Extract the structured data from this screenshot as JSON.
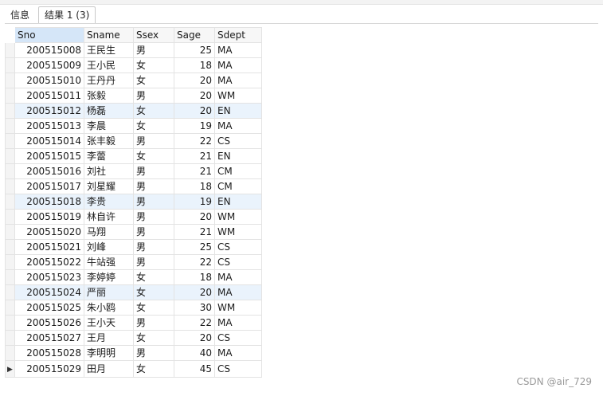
{
  "tabs": [
    {
      "label": "信息",
      "active": false
    },
    {
      "label": "结果 1 (3)",
      "active": true
    }
  ],
  "table": {
    "columns": [
      "Sno",
      "Sname",
      "Ssex",
      "Sage",
      "Sdept"
    ],
    "current_row_marker": "▶",
    "rows": [
      [
        "200515008",
        "王民生",
        "男",
        "25",
        "MA"
      ],
      [
        "200515009",
        "王小民",
        "女",
        "18",
        "MA"
      ],
      [
        "200515010",
        "王丹丹",
        "女",
        "20",
        "MA"
      ],
      [
        "200515011",
        "张毅",
        "男",
        "20",
        "WM"
      ],
      [
        "200515012",
        "杨磊",
        "女",
        "20",
        "EN"
      ],
      [
        "200515013",
        "李晨",
        "女",
        "19",
        "MA"
      ],
      [
        "200515014",
        "张丰毅",
        "男",
        "22",
        "CS"
      ],
      [
        "200515015",
        "李蕾",
        "女",
        "21",
        "EN"
      ],
      [
        "200515016",
        "刘社",
        "男",
        "21",
        "CM"
      ],
      [
        "200515017",
        "刘星耀",
        "男",
        "18",
        "CM"
      ],
      [
        "200515018",
        "李贵",
        "男",
        "19",
        "EN"
      ],
      [
        "200515019",
        "林自许",
        "男",
        "20",
        "WM"
      ],
      [
        "200515020",
        "马翔",
        "男",
        "21",
        "WM"
      ],
      [
        "200515021",
        "刘峰",
        "男",
        "25",
        "CS"
      ],
      [
        "200515022",
        "牛站强",
        "男",
        "22",
        "CS"
      ],
      [
        "200515023",
        "李婷婷",
        "女",
        "18",
        "MA"
      ],
      [
        "200515024",
        "严丽",
        "女",
        "20",
        "MA"
      ],
      [
        "200515025",
        "朱小鸥",
        "女",
        "30",
        "WM"
      ],
      [
        "200515026",
        "王小天",
        "男",
        "22",
        "MA"
      ],
      [
        "200515027",
        "王月",
        "女",
        "20",
        "CS"
      ],
      [
        "200515028",
        "李明明",
        "男",
        "40",
        "MA"
      ],
      [
        "200515029",
        "田月",
        "女",
        "45",
        "CS"
      ]
    ]
  },
  "watermark": "CSDN @air_729"
}
